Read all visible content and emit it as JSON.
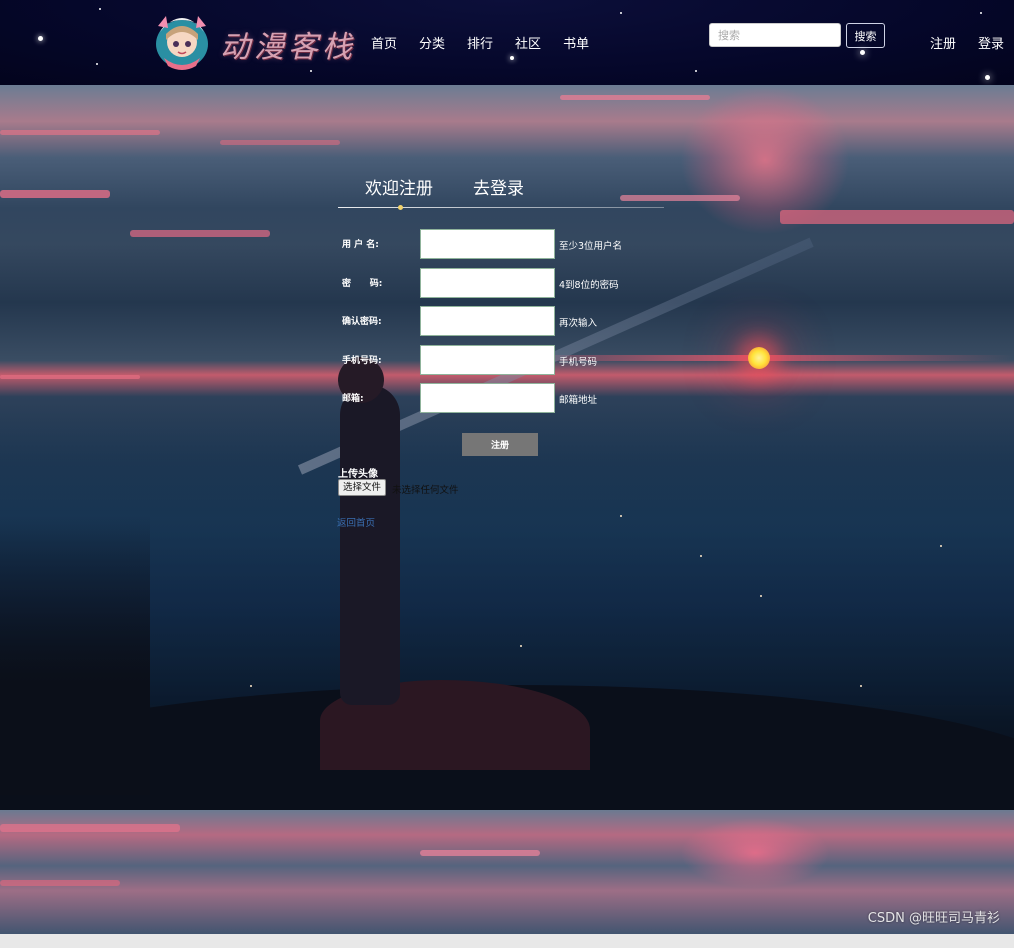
{
  "header": {
    "brand_text": "动漫客栈",
    "nav": [
      "首页",
      "分类",
      "排行",
      "社区",
      "书单"
    ],
    "search": {
      "placeholder": "搜索",
      "button_label": "搜索"
    },
    "auth": {
      "register_label": "注册",
      "login_label": "登录"
    }
  },
  "form": {
    "tabs": {
      "register": "欢迎注册",
      "login": "去登录"
    },
    "fields": [
      {
        "label": "用 户 名:",
        "hint": "至少3位用户名",
        "value": ""
      },
      {
        "label": "密      码:",
        "hint": "4到8位的密码",
        "value": ""
      },
      {
        "label": "确认密码:",
        "hint": "再次输入",
        "value": ""
      },
      {
        "label": "手机号码:",
        "hint": "手机号码",
        "value": ""
      },
      {
        "label": "邮箱:",
        "hint": "邮箱地址",
        "value": ""
      }
    ],
    "submit_label": "注册",
    "avatar_label": "上传头像",
    "file_button_label": "选择文件",
    "file_status": "未选择任何文件",
    "back_link": "返回首页"
  },
  "watermark": "CSDN @旺旺司马青衫",
  "colors": {
    "header_bg": "#05072a",
    "accent_pink": "#e85a74",
    "link_blue": "#3a6fb2",
    "button_gray": "#767676"
  }
}
